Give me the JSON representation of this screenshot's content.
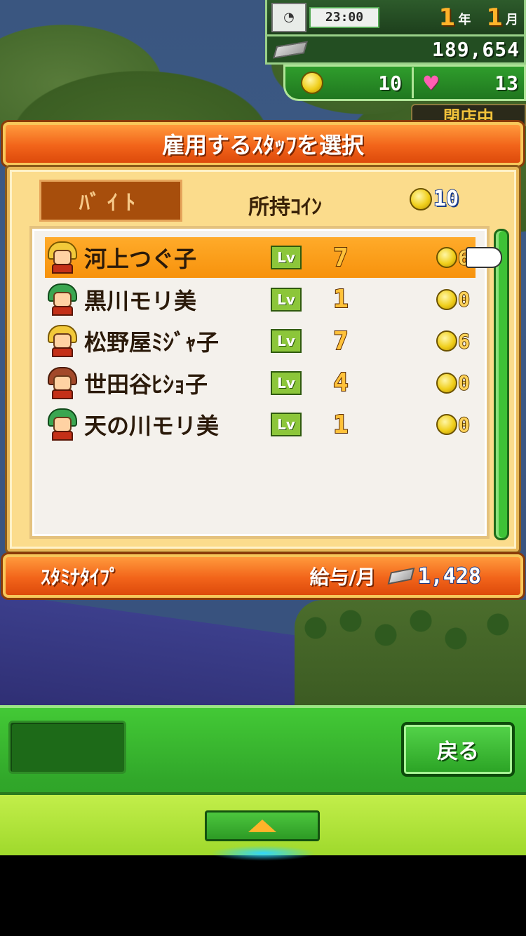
{
  "hud": {
    "time": "23:00",
    "year_value": "1",
    "year_unit": "年",
    "month_value": "1",
    "month_unit": "月",
    "money": "189,654",
    "coins": "10",
    "hearts": "13",
    "status_badge": "閉店中"
  },
  "dialog": {
    "title": "雇用するｽﾀｯﾌを選択",
    "tab_label": "ﾊﾞｲﾄ",
    "coins_label": "所持ｺｲﾝ",
    "coins_value": "10",
    "lv_badge": "Lv",
    "staff": [
      {
        "name": "河上つぐ子",
        "level": "7",
        "cost": "6",
        "hair": "yellow",
        "selected": true
      },
      {
        "name": "黒川モリ美",
        "level": "1",
        "cost": "0",
        "hair": "green",
        "selected": false
      },
      {
        "name": "松野屋ﾐｼﾞｬ子",
        "level": "7",
        "cost": "6",
        "hair": "yellow",
        "selected": false
      },
      {
        "name": "世田谷ﾋｼｮ子",
        "level": "4",
        "cost": "0",
        "hair": "brown",
        "selected": false
      },
      {
        "name": "天の川モリ美",
        "level": "1",
        "cost": "0",
        "hair": "green",
        "selected": false
      }
    ],
    "type_label": "ｽﾀﾐﾅﾀｲﾌﾟ",
    "salary_label": "給与/月",
    "salary_value": "1,428"
  },
  "menu": {
    "back_label": "戻る"
  },
  "colors": {
    "orange_bar": "#f2641a",
    "panel_bg": "#fbdc8c",
    "selected_row": "#f7920c",
    "menu_green": "#31a72a"
  }
}
